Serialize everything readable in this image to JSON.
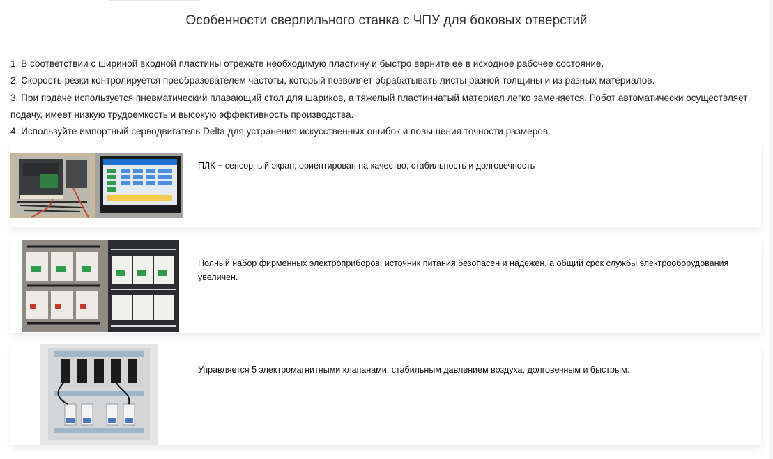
{
  "title": "Особенности сверлильного станка с ЧПУ для боковых отверстий",
  "points": [
    "1. В соответствии с шириной входной пластины отрежьте необходимую пластину и быстро верните ее в исходное рабочее состояние.",
    "2. Скорость резки контролируется преобразователем частоты, который позволяет обрабатывать листы разной толщины и из разных материалов.",
    "3. При подаче используется пневматический плавающий стол для шариков, а тяжелый пластинчатый материал легко заменяется. Робот автоматически осуществляет подачу, имеет низкую трудоемкость и высокую эффективность производства.",
    "4. Используйте импортный серводвигатель Delta для устранения искусственных ошибок и повышения точности размеров."
  ],
  "features": [
    {
      "text": "ПЛК + сенсорный экран, ориентирован на качество, стабильность и долговечность",
      "image": "plc-touchscreen-photo"
    },
    {
      "text": "Полный набор фирменных электроприборов, источник питания безопасен и надежен, а общий срок службы электрооборудования увеличен.",
      "image": "electrical-contactors-photo"
    },
    {
      "text": "Управляется 5 электромагнитными клапанами, стабильным давлением воздуха, долговечным и быстрым.",
      "image": "solenoid-valves-photo"
    }
  ],
  "colors": {
    "accent_screen": "#1f6fd1",
    "contactor_green": "#2e9e4a",
    "panel_gray": "#d9dcde"
  }
}
